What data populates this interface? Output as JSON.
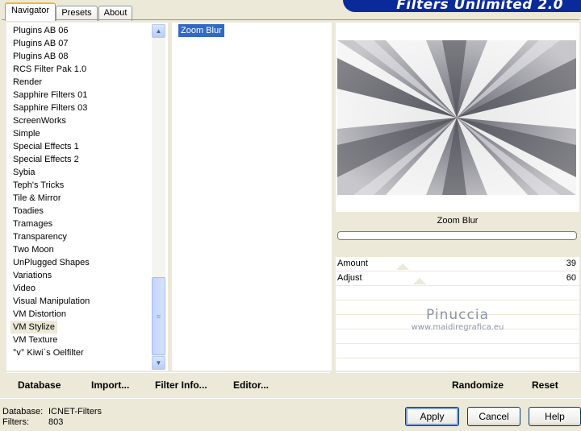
{
  "tabs": [
    {
      "label": "Navigator",
      "active": true
    },
    {
      "label": "Presets",
      "active": false
    },
    {
      "label": "About",
      "active": false
    }
  ],
  "banner": {
    "title": "Filters Unlimited 2.0"
  },
  "categories": {
    "items": [
      "Plugins AB 06",
      "Plugins AB 07",
      "Plugins AB 08",
      "RCS Filter Pak 1.0",
      "Render",
      "Sapphire Filters 01",
      "Sapphire Filters 03",
      "ScreenWorks",
      "Simple",
      "Special Effects 1",
      "Special Effects 2",
      "Sybia",
      "Teph's Tricks",
      "Tile & Mirror",
      "Toadies",
      "Tramages",
      "Transparency",
      "Two Moon",
      "UnPlugged Shapes",
      "Variations",
      "Video",
      "Visual Manipulation",
      "VM Distortion",
      "VM Stylize",
      "VM Texture",
      "°v° Kiwi`s Oelfilter"
    ],
    "selected": "VM Stylize"
  },
  "filters": {
    "items": [
      "Zoom Blur"
    ],
    "selected": "Zoom Blur"
  },
  "preview": {
    "filter_name": "Zoom Blur",
    "progress": 0
  },
  "params": [
    {
      "label": "Amount",
      "value": "39",
      "level": 39
    },
    {
      "label": "Adjust",
      "value": "60",
      "level": 60
    }
  ],
  "watermark": {
    "name": "Pinuccia",
    "url": "www.maidiregrafica.eu"
  },
  "commands": {
    "database": "Database",
    "import": "Import...",
    "filter_info": "Filter Info...",
    "editor": "Editor...",
    "randomize": "Randomize",
    "reset": "Reset"
  },
  "status": {
    "database_label": "Database:",
    "database_value": "ICNET-Filters",
    "filters_label": "Filters:",
    "filters_value": "803"
  },
  "buttons": {
    "apply": "Apply",
    "cancel": "Cancel",
    "help": "Help"
  },
  "colors": {
    "selection": "#316ac5",
    "banner": "#0a2a9a",
    "face": "#ece9d8"
  }
}
